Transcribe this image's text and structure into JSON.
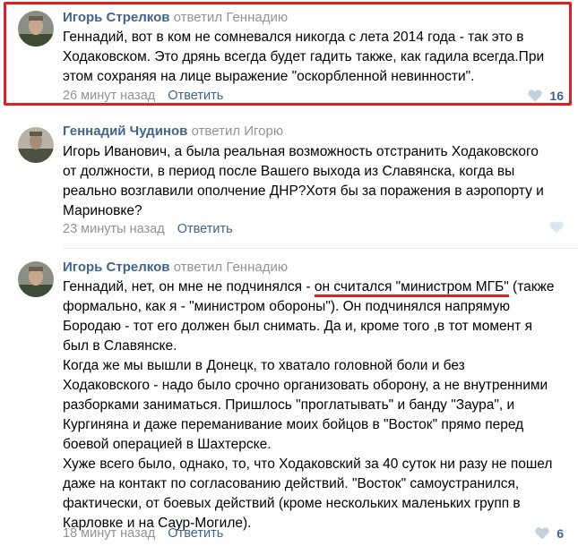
{
  "comments": [
    {
      "author": "Игорь Стрелков",
      "replied_to": "ответил Геннадию",
      "lines": [
        "Геннадий, вот в ком не сомневался никогда с лета 2014 года - так это в",
        "Ходаковском. Это дрянь всегда будет гадить также, как гадила всегда.При",
        "этом сохраняя на лице выражение \"оскорбленной невинности\"."
      ],
      "time": "26 минут назад",
      "reply_label": "Ответить",
      "likes": "16",
      "highlighted": true
    },
    {
      "author": "Геннадий Чудинов",
      "replied_to": "ответил Игорю",
      "lines": [
        "Игорь Иванович, а была реальная возможность отстранить Ходаковского",
        "от должности, в период после Вашего выхода из Славянска, когда вы",
        "реально возглавили ополчение ДНР?Хотя бы за поражения в аэропорту и",
        "Мариновке?"
      ],
      "time": "23 минуты назад",
      "reply_label": "Ответить",
      "likes": ""
    },
    {
      "author": "Игорь Стрелков",
      "replied_to": "ответил Геннадию",
      "first_line_pre": "Геннадий, нет, он мне не подчинялся - ",
      "first_line_underlined": "он считался \"министром МГБ\"",
      "first_line_post": " (также",
      "lines": [
        "формально, как я - \"министром обороны\"). Он подчинялся напрямую",
        "Бородаю - тот его должен был снимать. Да и, кроме того ,в тот момент я",
        "был в Славянске.",
        "Когда же мы вышли в Донецк, то хватало головной боли и без",
        "Ходаковского - надо было срочно организовать оборону, а не внутренними",
        "разборками заниматься. Пришлось \"проглатывать\" и банду \"Заура\", и",
        "Кургиняна и даже переманивание моих бойцов в \"Восток\" прямо перед",
        "боевой операцией в Шахтерске.",
        "Хуже всего было, однако, то, что Ходаковский за 40 суток ни разу не пошел",
        "даже на контакт по согласованию действий. \"Восток\" самоустранился,",
        "фактически, от боевых действий (кроме нескольких маленьких групп в",
        "Карловке и на Саур-Могиле)."
      ],
      "time": "18 минут назад",
      "reply_label": "Ответить",
      "likes": "6"
    }
  ],
  "colors": {
    "author": "#42648b",
    "meta": "#939393",
    "highlight": "#e02020"
  },
  "icons": [
    "avatar",
    "heart-icon"
  ]
}
